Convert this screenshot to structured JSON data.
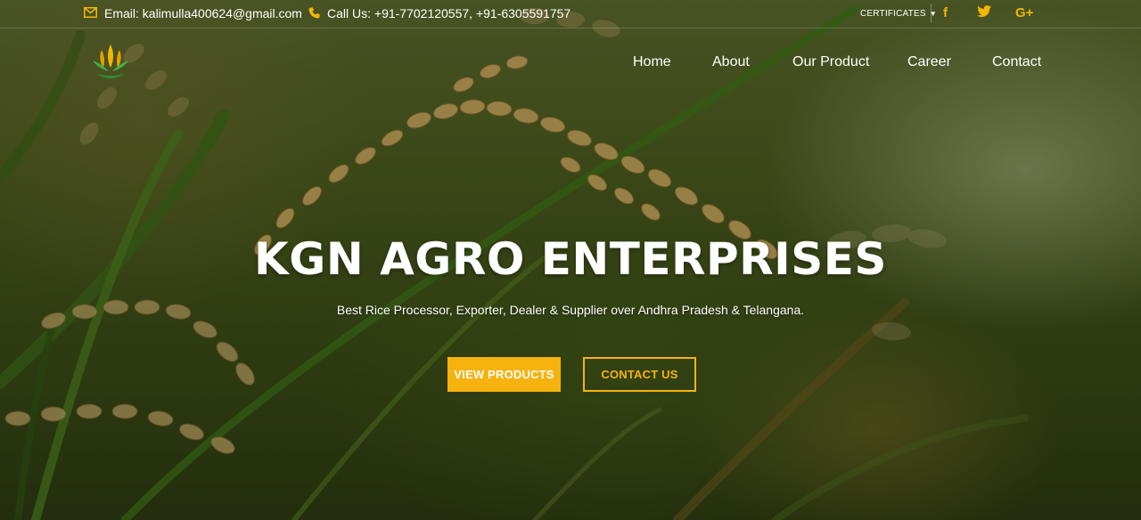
{
  "topbar": {
    "email_label": "Email: kalimulla400624@gmail.com",
    "phone_label": "Call Us: +91-7702120557, +91-6305591757",
    "certificates_label": "CERTIFICATES",
    "social": [
      {
        "name": "facebook",
        "glyph": "f"
      },
      {
        "name": "twitter",
        "glyph": "t"
      },
      {
        "name": "google-plus",
        "glyph": "G+"
      }
    ]
  },
  "nav": {
    "items": [
      {
        "label": "Home"
      },
      {
        "label": "About"
      },
      {
        "label": "Our Product"
      },
      {
        "label": "Career"
      },
      {
        "label": "Contact"
      }
    ]
  },
  "hero": {
    "title": "KGN AGRO ENTERPRISES",
    "subtitle": "Best Rice Processor, Exporter, Dealer & Supplier over Andhra Pradesh & Telangana.",
    "primary_button": "VIEW PRODUCTS",
    "secondary_button": "CONTACT US"
  },
  "colors": {
    "accent": "#f6b20f",
    "text": "#ffffff"
  },
  "icons": {
    "email": "envelope-icon",
    "phone": "phone-icon",
    "dropdown": "caret-down-icon"
  }
}
